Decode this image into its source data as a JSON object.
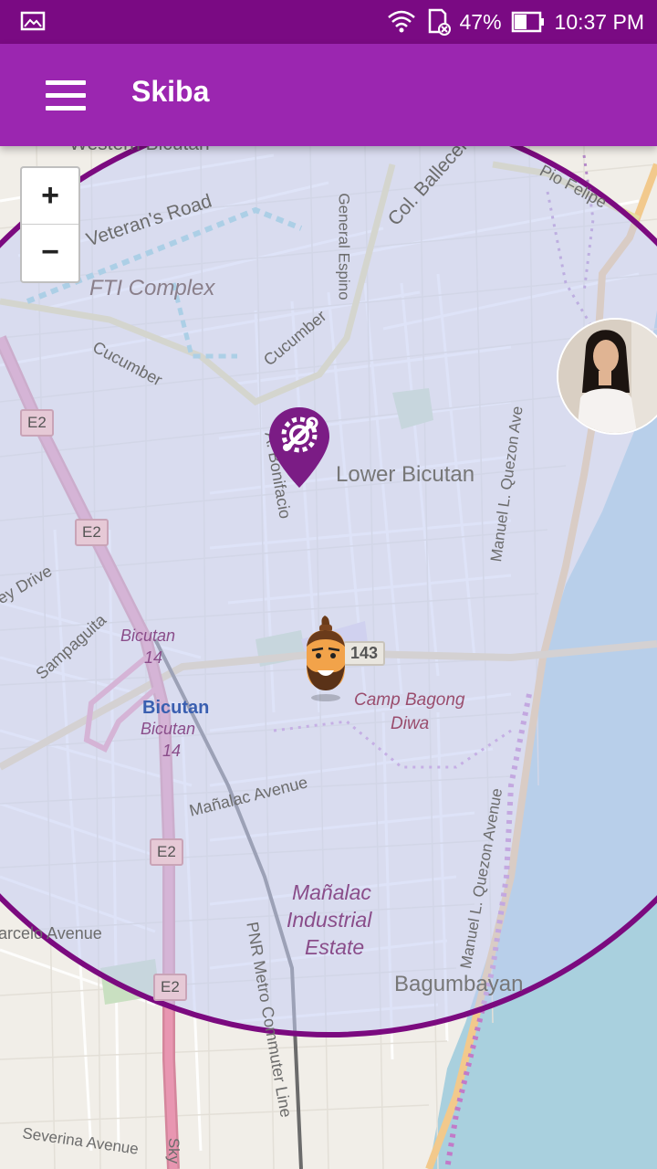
{
  "status_bar": {
    "battery": "47%",
    "time": "10:37 PM",
    "icons": [
      "image-icon",
      "wifi-icon",
      "sd-card-icon",
      "battery-icon"
    ]
  },
  "app_bar": {
    "title": "Skiba",
    "menu_icon": "hamburger-menu-icon"
  },
  "map": {
    "zoom_in_label": "+",
    "zoom_out_label": "−",
    "labels": {
      "weston": "Western Bicutan",
      "veterans": "Veteran's Road",
      "general_espino": "General Espino",
      "col_ballecer": "Col. Ballecer",
      "pio_felipe": "Pio Felipe",
      "fti": "FTI Complex",
      "cucumber1": "Cucumber",
      "cucumber2": "Cucumber",
      "bonifacio": "A. Bonifacio",
      "lower_bicutan": "Lower Bicutan",
      "mlq1": "Manuel L. Quezon Ave",
      "key_drive": "ey Drive",
      "sampaguita": "Sampaguita",
      "bicutan_station": "Bicutan",
      "bicutan_pnr1": "Bicutan",
      "bicutan_pnr2": "Bicutan",
      "camp": "Camp Bagong",
      "camp2": "Diwa",
      "manalac_ave": "Mañalac Avenue",
      "manalac_ind1": "Mañalac",
      "manalac_ind2": "Industrial",
      "manalac_ind3": "Estate",
      "pnr_line": "PNR Metro Commuter Line",
      "mlq2": "Manuel L. Quezon Avenue",
      "marcelo": "arcelo Avenue",
      "bagumbayan": "Bagumbayan",
      "severina": "Severina Avenue",
      "sky": "Sky",
      "l14a": "14",
      "l14b": "14"
    },
    "shields": [
      "E2",
      "E2",
      "E2",
      "E2"
    ],
    "road_number": "143",
    "radius_color": "#7b0a7f",
    "pin_color": "#7b1c85",
    "pin_icon": "wrench-gear-icon",
    "user_marker": "cartoon-man-avatar",
    "profile_photo": "profile-photo-avatar"
  }
}
